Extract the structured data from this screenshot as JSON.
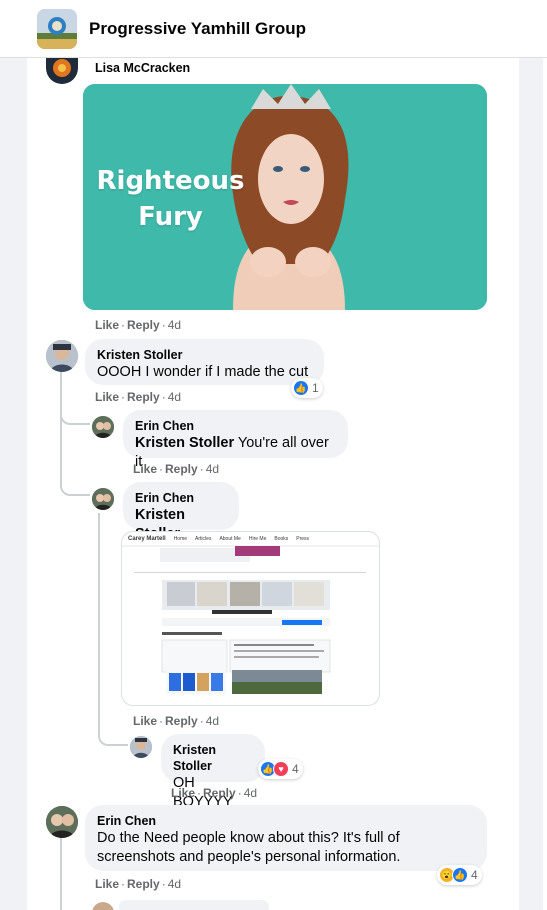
{
  "header": {
    "group_name": "Progressive Yamhill Group"
  },
  "post_comment": {
    "author": "Lisa McCracken",
    "gif_text_line1": "Righteous",
    "gif_text_line2": "Fury",
    "like": "Like",
    "reply": "Reply",
    "time": "4d"
  },
  "comments": [
    {
      "author": "Kristen Stoller",
      "text": "OOOH I wonder if I made the cut",
      "like": "Like",
      "reply": "Reply",
      "time": "4d",
      "reaction_count": "1",
      "replies": [
        {
          "author": "Erin Chen",
          "tag": "Kristen Stoller",
          "text": " You're all over it",
          "like": "Like",
          "reply": "Reply",
          "time": "4d"
        },
        {
          "author": "Erin Chen",
          "tag": "Kristen Stoller",
          "text": "",
          "like": "Like",
          "reply": "Reply",
          "time": "4d",
          "attachment": {
            "site_name": "Carey Martell",
            "nav": [
              "Home",
              "Articles",
              "About Me",
              "Hire Me",
              "Books",
              "Press"
            ]
          }
        },
        {
          "author": "Kristen Stoller",
          "text": "OH BOYYYY",
          "like": "Like",
          "reply": "Reply",
          "time": "4d",
          "reaction_count": "4"
        }
      ]
    },
    {
      "author": "Erin Chen",
      "text": "Do the Need people know about this? It's full of screenshots and people's personal information.",
      "like": "Like",
      "reply": "Reply",
      "time": "4d",
      "reaction_count": "4"
    }
  ],
  "colors": {
    "like_blue": "#1877f2",
    "love_red": "#f33e58",
    "wow_yellow": "#f7b125",
    "gif_bg": "#3fb9a9"
  },
  "icons": [
    "group-logo",
    "like-reaction-icon",
    "love-reaction-icon",
    "wow-reaction-icon"
  ]
}
